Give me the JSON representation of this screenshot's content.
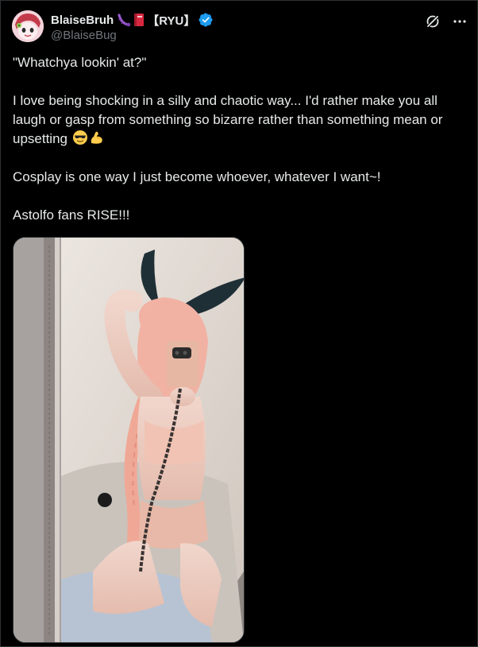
{
  "author": {
    "display_name": "BlaiseBruh",
    "name_tag": "【RYU】",
    "handle": "@BlaiseBug",
    "verified": true,
    "avatar_icon": "avatar-anime-character",
    "name_emojis": [
      "bug-emoji",
      "red-book-emoji"
    ]
  },
  "header_actions": [
    "grok-icon",
    "more-icon"
  ],
  "tweet": {
    "paragraphs": [
      "\"Whatchya lookin' at?\"",
      "I love being shocking in a silly and chaotic way... I'd rather make you all laugh or gasp from something so bizarre rather than something mean or upsetting",
      "Cosplay is one way I just become whoever, whatever I want~!",
      "Astolfo fans RISE!!!"
    ],
    "emojis_after_paragraph_2": [
      "sunglasses-emoji",
      "flexed-biceps-emoji"
    ]
  },
  "media": {
    "type": "photo",
    "subject": "cosplay-mirror-selfie"
  },
  "colors": {
    "background": "#000000",
    "text": "#e7e9ea",
    "secondary_text": "#71767b",
    "verified_blue": "#1d9bf0",
    "border": "#2f3336"
  }
}
